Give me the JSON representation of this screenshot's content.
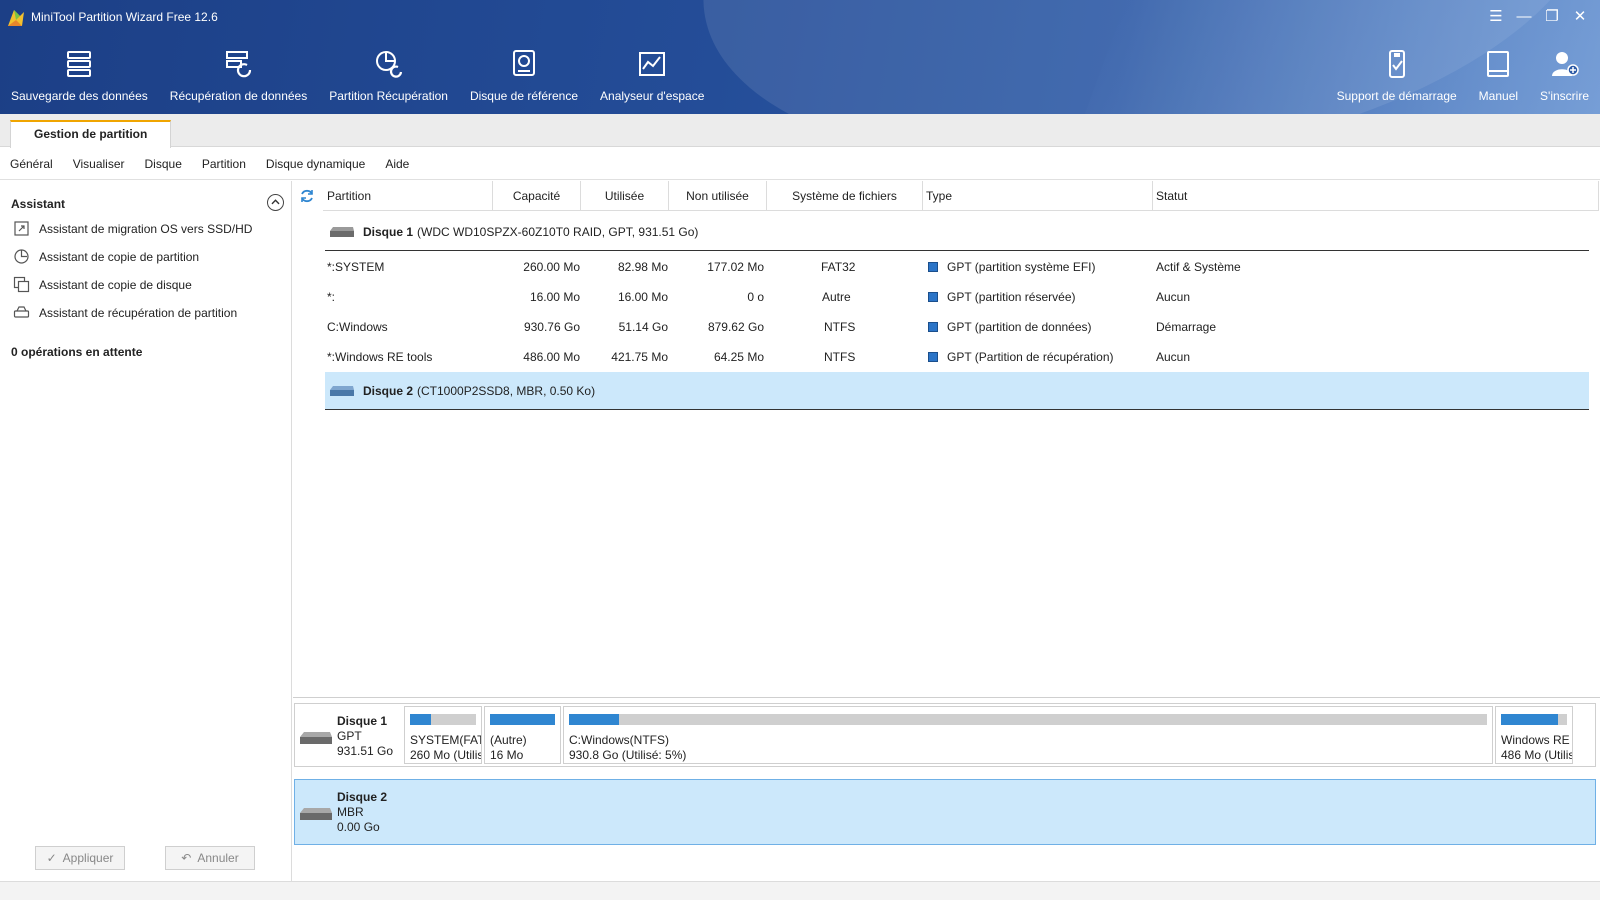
{
  "window": {
    "title": "MiniTool Partition Wizard Free 12.6"
  },
  "toolbar": {
    "left": [
      {
        "label": "Sauvegarde des données",
        "icon": "backup-icon"
      },
      {
        "label": "Récupération de données",
        "icon": "data-recovery-icon"
      },
      {
        "label": "Partition Récupération",
        "icon": "partition-recovery-icon"
      },
      {
        "label": "Disque de référence",
        "icon": "disk-benchmark-icon"
      },
      {
        "label": "Analyseur d'espace",
        "icon": "space-analyzer-icon"
      }
    ],
    "right": [
      {
        "label": "Support de démarrage",
        "icon": "bootable-media-icon"
      },
      {
        "label": "Manuel",
        "icon": "manual-icon"
      },
      {
        "label": "S'inscrire",
        "icon": "register-icon"
      }
    ]
  },
  "tabs": {
    "active": "Gestion de partition"
  },
  "menu": [
    "Général",
    "Visualiser",
    "Disque",
    "Partition",
    "Disque dynamique",
    "Aide"
  ],
  "sidebar": {
    "title": "Assistant",
    "wizards": [
      "Assistant de migration OS vers SSD/HD",
      "Assistant de copie de partition",
      "Assistant de copie de disque",
      "Assistant de récupération de partition"
    ],
    "pending": "0 opérations en attente",
    "apply": "Appliquer",
    "undo": "Annuler"
  },
  "table": {
    "columns": [
      "Partition",
      "Capacité",
      "Utilisée",
      "Non utilisée",
      "Système de fichiers",
      "Type",
      "Statut"
    ],
    "disk1": {
      "name": "Disque 1",
      "info": "(WDC WD10SPZX-60Z10T0 RAID, GPT, 931.51 Go)"
    },
    "rows": [
      {
        "partition": "*:SYSTEM",
        "capacity": "260.00 Mo",
        "used": "82.98 Mo",
        "unused": "177.02 Mo",
        "fs": "FAT32",
        "type": "GPT (partition système EFI)",
        "status": "Actif & Système"
      },
      {
        "partition": "*:",
        "capacity": "16.00 Mo",
        "used": "16.00 Mo",
        "unused": "0 o",
        "fs": "Autre",
        "type": "GPT (partition réservée)",
        "status": "Aucun"
      },
      {
        "partition": "C:Windows",
        "capacity": "930.76 Go",
        "used": "51.14 Go",
        "unused": "879.62 Go",
        "fs": "NTFS",
        "type": "GPT (partition de données)",
        "status": "Démarrage"
      },
      {
        "partition": "*:Windows RE tools",
        "capacity": "486.00 Mo",
        "used": "421.75 Mo",
        "unused": "64.25 Mo",
        "fs": "NTFS",
        "type": "GPT (Partition de récupération)",
        "status": "Aucun"
      }
    ],
    "disk2": {
      "name": "Disque 2",
      "info": "(CT1000P2SSD8, MBR, 0.50 Ko)"
    }
  },
  "diskmap": {
    "disk1": {
      "name": "Disque 1",
      "style": "GPT",
      "size": "931.51 Go",
      "segments": [
        {
          "l1": "SYSTEM(FAT3",
          "l2": "260 Mo (Utilis",
          "used": 0.32
        },
        {
          "l1": "(Autre)",
          "l2": "16 Mo",
          "used": 1.0
        },
        {
          "l1": "C:Windows(NTFS)",
          "l2": "930.8 Go (Utilisé: 5%)",
          "used": 0.055
        },
        {
          "l1": "Windows RE ·",
          "l2": "486 Mo (Utilis",
          "used": 0.87
        }
      ]
    },
    "disk2": {
      "name": "Disque 2",
      "style": "MBR",
      "size": "0.00 Go"
    }
  },
  "colors": {
    "accent": "#2f86d1",
    "selection": "#cce8fb",
    "tab_accent": "#f0a500"
  }
}
